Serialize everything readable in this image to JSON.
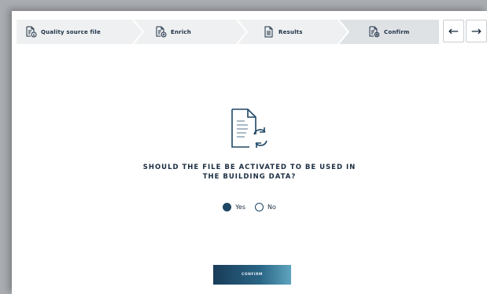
{
  "steps": [
    {
      "label": "Quality source file",
      "icon": "file-info-icon"
    },
    {
      "label": "Enrich",
      "icon": "file-add-icon"
    },
    {
      "label": "Results",
      "icon": "file-document-icon"
    },
    {
      "label": "Confirm",
      "icon": "file-settings-icon"
    }
  ],
  "active_step": "Confirm",
  "nav": {
    "prev": "←",
    "next": "→"
  },
  "question": {
    "line1": "SHOULD THE FILE BE ACTIVATED TO BE USED IN",
    "line2": "THE BUILDING DATA?"
  },
  "options": {
    "yes": "Yes",
    "no": "No",
    "selected": "Yes"
  },
  "confirm_label": "CONFIRM",
  "colors": {
    "primary": "#1e4664",
    "text": "#1b2d42",
    "stepper_bg": "#eef0f1"
  }
}
